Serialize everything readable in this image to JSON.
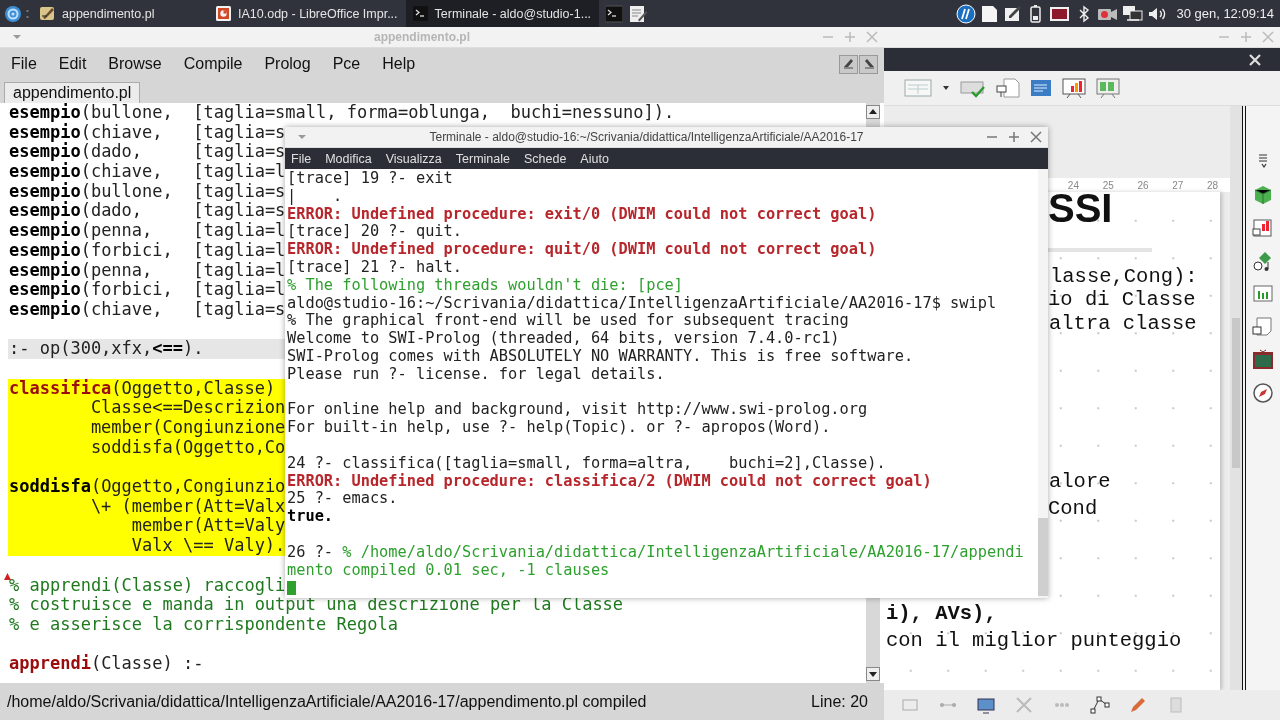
{
  "taskbar": {
    "tasks": [
      {
        "kind": "editor",
        "label": "appendimento.pl",
        "selected": false
      },
      {
        "kind": "impress",
        "label": "IA10.odp - LibreOffice Impr...",
        "selected": false
      },
      {
        "kind": "terminal",
        "label": "Terminale - aldo@studio-1...",
        "selected": true
      }
    ],
    "clock": "30 gen, 12:09:14"
  },
  "editor": {
    "title": "appendimento.pl",
    "menu": [
      "File",
      "Edit",
      "Browse",
      "Compile",
      "Prolog",
      "Pce",
      "Help"
    ],
    "tab": {
      "label": "appendimento.pl",
      "selected": true
    },
    "blocks": [
      {
        "kind": "code",
        "selected": false,
        "flagged": false,
        "lines": [
          [
            {
              "text": "esempio",
              "kind": "functor"
            },
            {
              "text": "(bullone,  [taglia=small, forma=oblunga,  buchi=nessuno]).",
              "kind": "plain"
            }
          ],
          [
            {
              "text": "esempio",
              "kind": "functor"
            },
            {
              "text": "(chiave,   [taglia=s",
              "kind": "plain"
            }
          ],
          [
            {
              "text": "esempio",
              "kind": "functor"
            },
            {
              "text": "(dado,     [taglia=s",
              "kind": "plain"
            }
          ],
          [
            {
              "text": "esempio",
              "kind": "functor"
            },
            {
              "text": "(chiave,   [taglia=l",
              "kind": "plain"
            }
          ],
          [
            {
              "text": "esempio",
              "kind": "functor"
            },
            {
              "text": "(bullone,  [taglia=s",
              "kind": "plain"
            }
          ],
          [
            {
              "text": "esempio",
              "kind": "functor"
            },
            {
              "text": "(dado,     [taglia=s",
              "kind": "plain"
            }
          ],
          [
            {
              "text": "esempio",
              "kind": "functor"
            },
            {
              "text": "(penna,    [taglia=l",
              "kind": "plain"
            }
          ],
          [
            {
              "text": "esempio",
              "kind": "functor"
            },
            {
              "text": "(forbici,  [taglia=l",
              "kind": "plain"
            }
          ],
          [
            {
              "text": "esempio",
              "kind": "functor"
            },
            {
              "text": "(penna,    [taglia=l",
              "kind": "plain"
            }
          ],
          [
            {
              "text": "esempio",
              "kind": "functor"
            },
            {
              "text": "(forbici,  [taglia=l",
              "kind": "plain"
            }
          ],
          [
            {
              "text": "esempio",
              "kind": "functor"
            },
            {
              "text": "(chiave,   [taglia=s",
              "kind": "plain"
            }
          ]
        ]
      },
      {
        "kind": "directive",
        "selected": false,
        "flagged": false,
        "lines": [
          [
            {
              "text": ":- op(300,xfx,",
              "kind": "plain"
            },
            {
              "text": "<==",
              "kind": "functor"
            },
            {
              "text": ").",
              "kind": "plain"
            }
          ]
        ]
      },
      {
        "kind": "code",
        "selected": true,
        "flagged": false,
        "lines": [
          [
            {
              "text": "classifica",
              "kind": "head"
            },
            {
              "text": "(Oggetto,Classe)",
              "kind": "plain"
            }
          ],
          [
            {
              "text": "        Classe<==Descrizion",
              "kind": "plain"
            }
          ],
          [
            {
              "text": "        member(Congiunzione",
              "kind": "plain"
            }
          ],
          [
            {
              "text": "        soddisfa(Oggetto,Co",
              "kind": "plain"
            }
          ]
        ]
      },
      {
        "kind": "code",
        "selected": true,
        "flagged": false,
        "lines": [
          [
            {
              "text": "soddisfa",
              "kind": "functor"
            },
            {
              "text": "(Oggetto,Congiunzio",
              "kind": "plain"
            }
          ],
          [
            {
              "text": "        \\+ (member(Att=Valx",
              "kind": "plain"
            }
          ],
          [
            {
              "text": "            member(Att=Valy",
              "kind": "plain"
            }
          ],
          [
            {
              "text": "            Valx \\== Valy).",
              "kind": "plain"
            }
          ]
        ]
      },
      {
        "kind": "code",
        "selected": false,
        "flagged": true,
        "lines": [
          [
            {
              "text": "% apprendi(Classe) raccogli",
              "kind": "comment"
            }
          ],
          [
            {
              "text": "% costruisce e manda in output una descrizione per la Classe",
              "kind": "comment"
            }
          ],
          [
            {
              "text": "% e asserisce la corrispondente Regola",
              "kind": "comment"
            }
          ]
        ]
      },
      {
        "kind": "code",
        "selected": false,
        "flagged": false,
        "lines": [
          [
            {
              "text": "apprendi",
              "kind": "head"
            },
            {
              "text": "(Classe) :-",
              "kind": "plain"
            }
          ]
        ]
      }
    ],
    "status": {
      "message": "/home/aldo/Scrivania/didattica/IntelligenzaArtificiale/AA2016-17/appendimento.pl compiled",
      "position": "Line: 20"
    }
  },
  "terminal": {
    "title": "Terminale - aldo@studio-16:~/Scrivania/didattica/IntelligenzaArtificiale/AA2016-17",
    "menu": [
      "File",
      "Modifica",
      "Visualizza",
      "Terminale",
      "Schede",
      "Aiuto"
    ],
    "blocks": [
      [
        [
          {
            "text": "[trace] 19 ?- exit",
            "kind": "plain"
          }
        ],
        [
          {
            "text": "|    .",
            "kind": "plain"
          }
        ],
        [
          {
            "text": "ERROR: Undefined procedure: exit/0 (DWIM could not correct goal)",
            "kind": "error"
          }
        ],
        [
          {
            "text": "[trace] 20 ?- quit.",
            "kind": "plain"
          }
        ],
        [
          {
            "text": "ERROR: Undefined procedure: quit/0 (DWIM could not correct goal)",
            "kind": "error"
          }
        ],
        [
          {
            "text": "[trace] 21 ?- halt.",
            "kind": "plain"
          }
        ],
        [
          {
            "text": "% The following threads wouldn't die: [pce]",
            "kind": "comment"
          }
        ],
        [
          {
            "text": "aldo@studio-16:~/Scrivania/didattica/IntelligenzaArtificiale/AA2016-17$ swipl",
            "kind": "plain"
          }
        ],
        [
          {
            "text": "% The graphical front-end will be used for subsequent tracing",
            "kind": "plain"
          }
        ],
        [
          {
            "text": "Welcome to SWI-Prolog (threaded, 64 bits, version 7.4.0-rc1)",
            "kind": "plain"
          }
        ],
        [
          {
            "text": "SWI-Prolog comes with ABSOLUTELY NO WARRANTY. This is free software.",
            "kind": "plain"
          }
        ],
        [
          {
            "text": "Please run ?- license. for legal details.",
            "kind": "plain"
          }
        ]
      ],
      [
        [
          {
            "text": "For online help and background, visit http://www.swi-prolog.org",
            "kind": "plain"
          }
        ],
        [
          {
            "text": "For built-in help, use ?- help(Topic). or ?- apropos(Word).",
            "kind": "plain"
          }
        ]
      ],
      [
        [
          {
            "text": "24 ?- classifica([taglia=small, forma=altra,    buchi=2],Classe).",
            "kind": "plain"
          }
        ],
        [
          {
            "text": "ERROR: Undefined procedure: classifica/2 (DWIM could not correct goal)",
            "kind": "error"
          }
        ],
        [
          {
            "text": "25 ?- emacs.",
            "kind": "plain"
          }
        ],
        [
          {
            "text": "true.",
            "kind": "bold"
          }
        ]
      ],
      [
        [
          {
            "text": "26 ?- ",
            "kind": "plain"
          },
          {
            "text": "% /home/aldo/Scrivania/didattica/IntelligenzaArtificiale/AA2016-17/appendi",
            "kind": "comment"
          }
        ],
        [
          {
            "text": "mento compiled 0.01 sec, -1 clauses",
            "kind": "comment"
          }
        ]
      ]
    ],
    "cursor": true
  },
  "impress": {
    "ruler": [
      "24",
      "25",
      "26",
      "27",
      "28"
    ],
    "slide_texts": [
      {
        "kind": "title",
        "text": "SSI"
      },
      {
        "kind": "body",
        "text": "lasse,Cong):"
      },
      {
        "kind": "body",
        "text": "io di Classe"
      },
      {
        "kind": "body",
        "text": "altra classe"
      },
      {
        "kind": "body",
        "text": "alore"
      },
      {
        "kind": "body",
        "text": "Cond"
      },
      {
        "kind": "strong",
        "text": "i), AVs),"
      },
      {
        "kind": "body",
        "text": "con il miglior punteggio"
      }
    ]
  }
}
